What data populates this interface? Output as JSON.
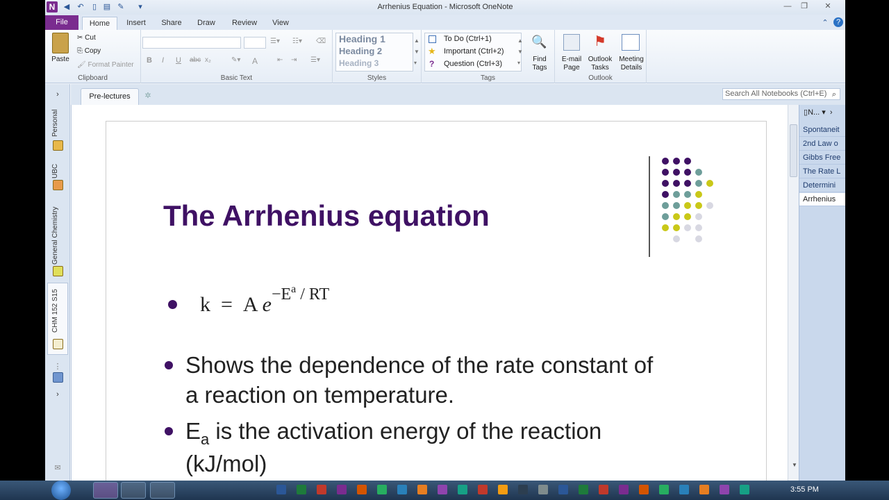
{
  "window": {
    "title": "Arrhenius Equation - Microsoft OneNote",
    "app_icon_letter": "N"
  },
  "ribbon_tabs": [
    {
      "label": "File"
    },
    {
      "label": "Home"
    },
    {
      "label": "Insert"
    },
    {
      "label": "Share"
    },
    {
      "label": "Draw"
    },
    {
      "label": "Review"
    },
    {
      "label": "View"
    }
  ],
  "clipboard": {
    "paste": "Paste",
    "cut": "Cut",
    "copy": "Copy",
    "format_painter": "Format Painter",
    "group_label": "Clipboard"
  },
  "basic_text": {
    "bold": "B",
    "italic": "I",
    "underline": "U",
    "strike": "abc",
    "subscript": "x₂",
    "font_color": "A",
    "group_label": "Basic Text"
  },
  "styles": {
    "items": [
      "Heading 1",
      "Heading 2",
      "Heading 3"
    ],
    "group_label": "Styles"
  },
  "tags": {
    "items": [
      "To Do (Ctrl+1)",
      "Important (Ctrl+2)",
      "Question (Ctrl+3)"
    ],
    "find_tags": "Find\nTags",
    "group_label": "Tags"
  },
  "outlook": {
    "email_page": "E-mail\nPage",
    "outlook_tasks": "Outlook\nTasks",
    "meeting_details": "Meeting\nDetails",
    "group_label": "Outlook"
  },
  "notebooks": [
    {
      "label": "Personal"
    },
    {
      "label": "UBC"
    },
    {
      "label": "General Chemistry"
    },
    {
      "label": "CHM 152 S15"
    }
  ],
  "section_tab": "Pre-lectures",
  "search_placeholder": "Search All Notebooks (Ctrl+E)",
  "pages": {
    "new_page": "N...",
    "items": [
      "Spontaneit",
      "2nd Law o",
      "Gibbs Free",
      "The Rate L",
      "Determini",
      "Arrhenius"
    ],
    "active_index": 5
  },
  "slide": {
    "title": "The Arrhenius equation",
    "formula": {
      "k": "k",
      "eq": "=",
      "A": "A",
      "e": "e",
      "exp_neg_E": "−E",
      "exp_sub_a": "a",
      "exp_rt": " / RT"
    },
    "bullet2_line1": "Shows the dependence of the rate constant of",
    "bullet2_line2": "a reaction on temperature.",
    "bullet3_E": "E",
    "bullet3_sub": "a",
    "bullet3_rest": " is the activation energy of the reaction",
    "bullet3_line2": "(kJ/mol)",
    "colors": {
      "title": "#3f1164",
      "dot_purple": "#3f1164",
      "dot_teal": "#6e9e9a",
      "dot_yellow": "#c9c818",
      "dot_light": "#d8d8e2"
    }
  },
  "taskbar": {
    "clock": "3:55 PM"
  }
}
